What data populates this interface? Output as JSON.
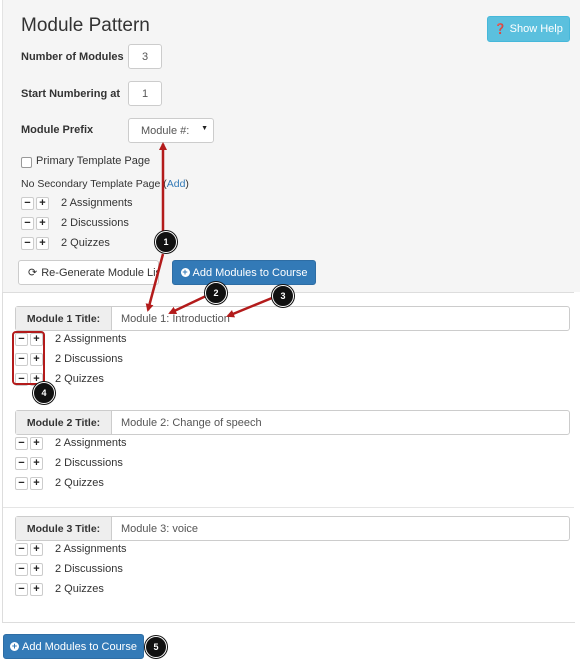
{
  "header": {
    "title": "Module Pattern",
    "help_button": "Show Help",
    "help_icon": "question-circle-icon"
  },
  "form": {
    "num_modules_label": "Number of Modules",
    "num_modules_value": "3",
    "start_numbering_label": "Start Numbering at",
    "start_numbering_value": "1",
    "prefix_label": "Module Prefix",
    "prefix_value": "Module #:",
    "primary_template_label": "Primary Template Page",
    "secondary_template_text": "No Secondary Template Page (",
    "secondary_add_link": "Add",
    "secondary_close": ")"
  },
  "template_items": [
    {
      "label": "2 Assignments"
    },
    {
      "label": "2 Discussions"
    },
    {
      "label": "2 Quizzes"
    }
  ],
  "buttons": {
    "minus": "−",
    "plus": "+",
    "regenerate": "Re-Generate Module List",
    "add_modules": "Add Modules to Course",
    "add_modules_bottom": "Add Modules to Course"
  },
  "modules": [
    {
      "title_label": "Module 1 Title:",
      "title_value": "Module 1: Introduction",
      "items": [
        "2 Assignments",
        "2 Discussions",
        "2 Quizzes"
      ]
    },
    {
      "title_label": "Module 2 Title:",
      "title_value": "Module 2: Change of speech",
      "items": [
        "2 Assignments",
        "2 Discussions",
        "2 Quizzes"
      ]
    },
    {
      "title_label": "Module 3 Title:",
      "title_value": "Module 3: voice",
      "items": [
        "2 Assignments",
        "2 Discussions",
        "2 Quizzes"
      ]
    }
  ],
  "callouts": [
    "1",
    "2",
    "3",
    "4",
    "5"
  ],
  "colors": {
    "primary": "#337ab7",
    "info": "#5bc0de",
    "annotation": "#b31b1b"
  }
}
